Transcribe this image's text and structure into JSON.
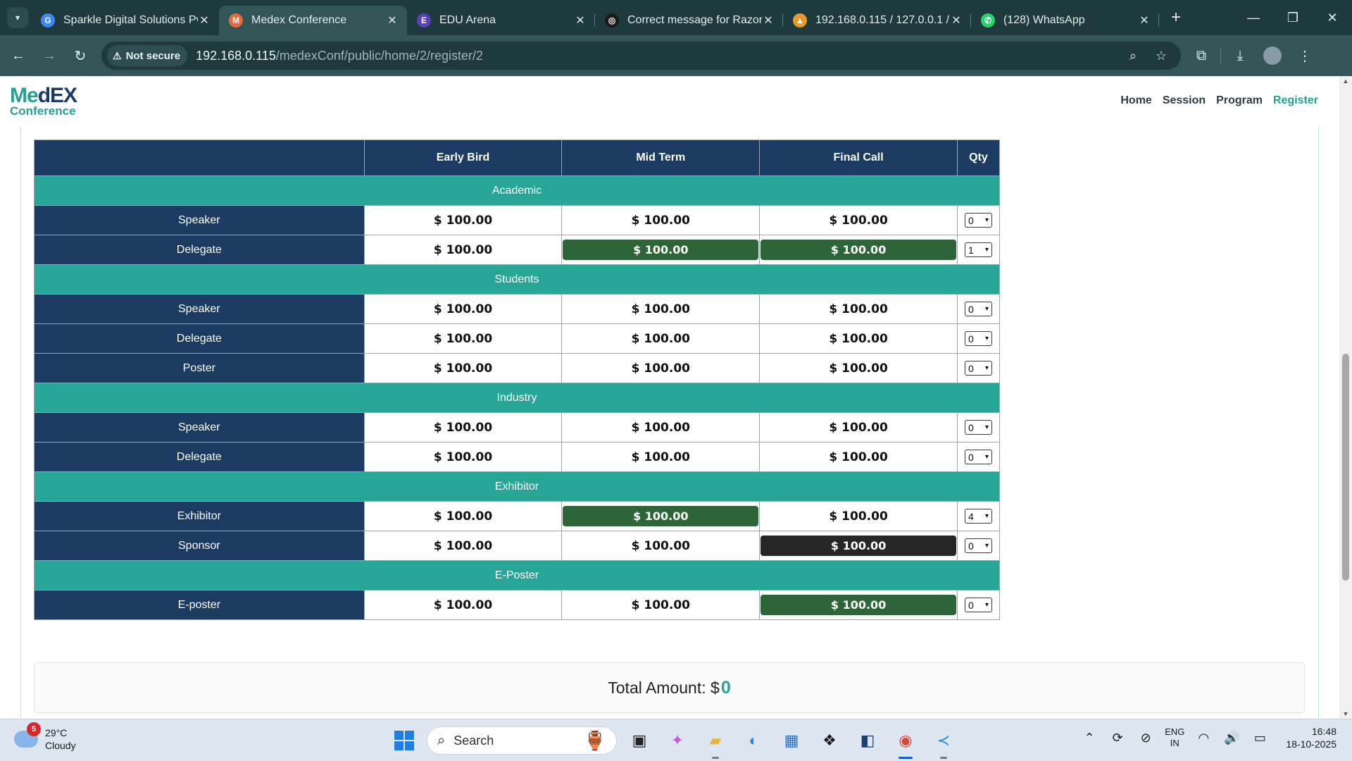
{
  "browser": {
    "tabs": [
      {
        "title": "Sparkle Digital Solutions Pvt",
        "fav_color": "#4285f4",
        "fav_glyph": "G",
        "active": false
      },
      {
        "title": "Medex Conference",
        "fav_color": "#e66a3c",
        "fav_glyph": "M",
        "active": true
      },
      {
        "title": "EDU Arena",
        "fav_color": "#5b3fb8",
        "fav_glyph": "E",
        "active": false
      },
      {
        "title": "Correct message for Razorpay",
        "fav_color": "#1a1a1a",
        "fav_glyph": "◎",
        "active": false
      },
      {
        "title": "192.168.0.115 / 127.0.0.1 / ",
        "fav_color": "#e89a2a",
        "fav_glyph": "▲",
        "active": false
      },
      {
        "title": "(128) WhatsApp",
        "fav_color": "#25d366",
        "fav_glyph": "✆",
        "active": false
      }
    ],
    "security_label": "Not secure",
    "url_host": "192.168.0.115",
    "url_path": "/medexConf/public/home/2/register/2"
  },
  "site": {
    "logo_top_a": "Me",
    "logo_top_b": "dEX",
    "logo_bottom": "Conference",
    "nav": [
      {
        "label": "Home",
        "active": false
      },
      {
        "label": "Session",
        "active": false
      },
      {
        "label": "Program",
        "active": false
      },
      {
        "label": "Register",
        "active": true
      }
    ]
  },
  "pricing": {
    "headers": [
      "",
      "Early Bird",
      "Mid Term",
      "Final Call",
      "Qty"
    ],
    "sections": [
      {
        "category": "Academic",
        "rows": [
          {
            "label": "Speaker",
            "prices": [
              "$ 100.00",
              "$ 100.00",
              "$ 100.00"
            ],
            "highlight": [
              "",
              "",
              ""
            ],
            "qty": "0"
          },
          {
            "label": "Delegate",
            "prices": [
              "$ 100.00",
              "$ 100.00",
              "$ 100.00"
            ],
            "highlight": [
              "",
              "green",
              "green"
            ],
            "qty": "1"
          }
        ]
      },
      {
        "category": "Students",
        "rows": [
          {
            "label": "Speaker",
            "prices": [
              "$ 100.00",
              "$ 100.00",
              "$ 100.00"
            ],
            "highlight": [
              "",
              "",
              ""
            ],
            "qty": "0"
          },
          {
            "label": "Delegate",
            "prices": [
              "$ 100.00",
              "$ 100.00",
              "$ 100.00"
            ],
            "highlight": [
              "",
              "",
              ""
            ],
            "qty": "0"
          },
          {
            "label": "Poster",
            "prices": [
              "$ 100.00",
              "$ 100.00",
              "$ 100.00"
            ],
            "highlight": [
              "",
              "",
              ""
            ],
            "qty": "0"
          }
        ]
      },
      {
        "category": "Industry",
        "rows": [
          {
            "label": "Speaker",
            "prices": [
              "$ 100.00",
              "$ 100.00",
              "$ 100.00"
            ],
            "highlight": [
              "",
              "",
              ""
            ],
            "qty": "0"
          },
          {
            "label": "Delegate",
            "prices": [
              "$ 100.00",
              "$ 100.00",
              "$ 100.00"
            ],
            "highlight": [
              "",
              "",
              ""
            ],
            "qty": "0"
          }
        ]
      },
      {
        "category": "Exhibitor",
        "rows": [
          {
            "label": "Exhibitor",
            "prices": [
              "$ 100.00",
              "$ 100.00",
              "$ 100.00"
            ],
            "highlight": [
              "",
              "green",
              ""
            ],
            "qty": "4"
          },
          {
            "label": "Sponsor",
            "prices": [
              "$ 100.00",
              "$ 100.00",
              "$ 100.00"
            ],
            "highlight": [
              "",
              "",
              "dark"
            ],
            "qty": "0"
          }
        ]
      },
      {
        "category": "E-Poster",
        "rows": [
          {
            "label": "E-poster",
            "prices": [
              "$ 100.00",
              "$ 100.00",
              "$ 100.00"
            ],
            "highlight": [
              "",
              "",
              "green"
            ],
            "qty": "0"
          }
        ]
      }
    ]
  },
  "total": {
    "label": "Total Amount: $",
    "value": "0"
  },
  "taskbar": {
    "weather_badge": "5",
    "temperature": "29°C",
    "condition": "Cloudy",
    "search_placeholder": "Search",
    "lang_top": "ENG",
    "lang_bottom": "IN",
    "time": "16:48",
    "date": "18-10-2025"
  },
  "colors": {
    "navy": "#1b3b63",
    "teal": "#27a697",
    "selected_green": "#2d6438",
    "selected_dark": "#262626"
  }
}
